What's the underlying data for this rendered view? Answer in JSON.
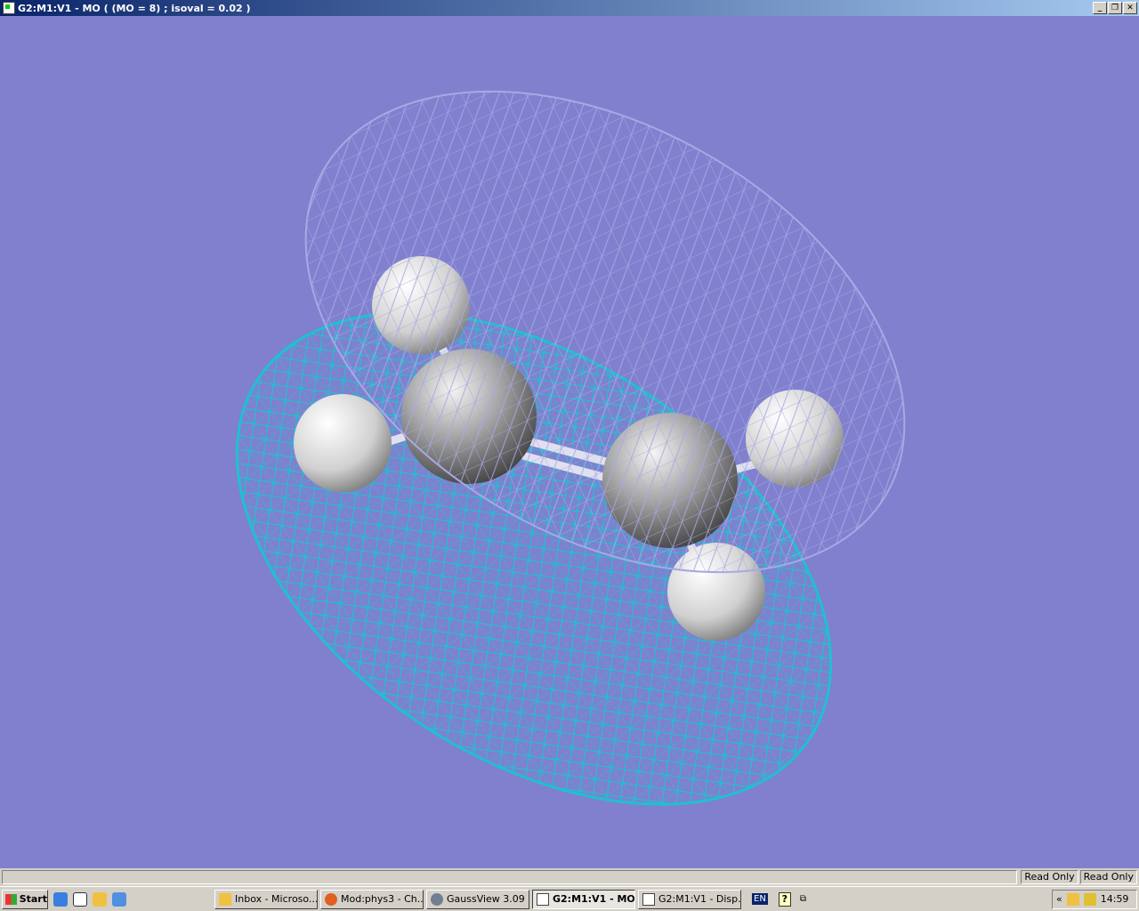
{
  "window": {
    "title": "G2:M1:V1 - MO ( (MO = 8) ; isoval = 0.02 )",
    "buttons": [
      "minimize",
      "restore",
      "close"
    ]
  },
  "viewport": {
    "background": "#8080cf",
    "positive_lobe_color": "#20c0d0",
    "negative_lobe_color": "#a0a0e0",
    "atom_color": "#d8d8d8"
  },
  "statusbar": {
    "message": "",
    "panels": [
      "Read Only",
      "Read Only"
    ]
  },
  "taskbar": {
    "start": "Start",
    "tasks": [
      {
        "label": "Inbox - Microso...",
        "icon": "outlook-icon"
      },
      {
        "label": "Mod:phys3 - Ch...",
        "icon": "firefox-icon"
      },
      {
        "label": "GaussView 3.09",
        "icon": "gaussview-icon"
      },
      {
        "label": "G2:M1:V1 - MO...",
        "icon": "gaussview-window-icon",
        "active": true
      },
      {
        "label": "G2:M1:V1 - Disp...",
        "icon": "gaussview-window-icon"
      }
    ],
    "language": "EN",
    "clock": "14:59"
  }
}
